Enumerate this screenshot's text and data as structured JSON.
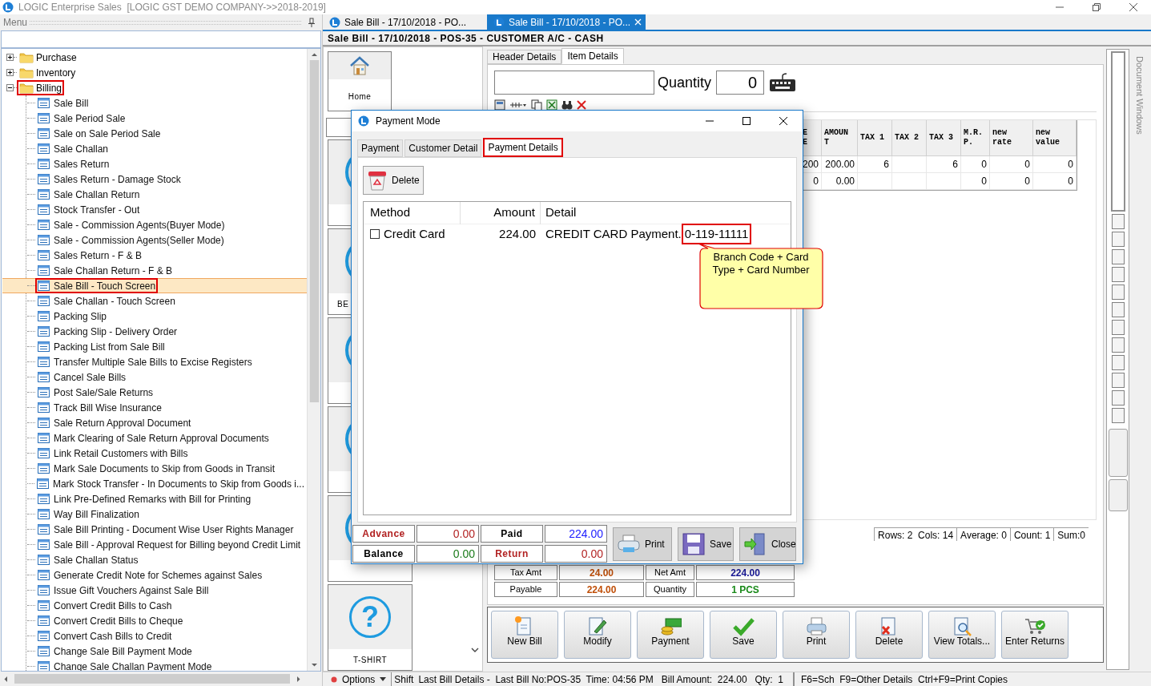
{
  "window": {
    "title": "LOGIC Enterprise Sales  [LOGIC GST DEMO COMPANY->>2018-2019]"
  },
  "menu": {
    "title": "Menu",
    "tree": [
      {
        "label": "Purchase",
        "expanded": false,
        "selected": false,
        "annotated": false
      },
      {
        "label": "Inventory",
        "expanded": false,
        "selected": false,
        "annotated": false
      },
      {
        "label": "Billing",
        "expanded": true,
        "selected": false,
        "annotated": true,
        "children": [
          {
            "label": "Sale Bill",
            "selected": false,
            "annotated": false
          },
          {
            "label": "Sale Period Sale",
            "selected": false,
            "annotated": false
          },
          {
            "label": "Sale on Sale Period Sale",
            "selected": false,
            "annotated": false
          },
          {
            "label": "Sale Challan",
            "selected": false,
            "annotated": false
          },
          {
            "label": "Sales Return",
            "selected": false,
            "annotated": false
          },
          {
            "label": "Sales Return - Damage Stock",
            "selected": false,
            "annotated": false
          },
          {
            "label": "Sale Challan Return",
            "selected": false,
            "annotated": false
          },
          {
            "label": "Stock Transfer - Out",
            "selected": false,
            "annotated": false
          },
          {
            "label": "Sale - Commission Agents(Buyer Mode)",
            "selected": false,
            "annotated": false
          },
          {
            "label": "Sale - Commission Agents(Seller Mode)",
            "selected": false,
            "annotated": false
          },
          {
            "label": "Sales Return - F & B",
            "selected": false,
            "annotated": false
          },
          {
            "label": "Sale Challan Return - F & B",
            "selected": false,
            "annotated": false
          },
          {
            "label": "Sale Bill - Touch Screen",
            "selected": true,
            "annotated": true
          },
          {
            "label": "Sale Challan - Touch Screen",
            "selected": false,
            "annotated": false
          },
          {
            "label": "Packing Slip",
            "selected": false,
            "annotated": false
          },
          {
            "label": "Packing Slip - Delivery Order",
            "selected": false,
            "annotated": false
          },
          {
            "label": "Packing List from Sale Bill",
            "selected": false,
            "annotated": false
          },
          {
            "label": "Transfer Multiple Sale Bills to Excise Registers",
            "selected": false,
            "annotated": false
          },
          {
            "label": "Cancel Sale Bills",
            "selected": false,
            "annotated": false
          },
          {
            "label": "Post Sale/Sale Returns",
            "selected": false,
            "annotated": false
          },
          {
            "label": "Track Bill Wise Insurance",
            "selected": false,
            "annotated": false
          },
          {
            "label": "Sale Return Approval Document",
            "selected": false,
            "annotated": false
          },
          {
            "label": "Mark Clearing of Sale Return Approval Documents",
            "selected": false,
            "annotated": false
          },
          {
            "label": "Link Retail Customers with Bills",
            "selected": false,
            "annotated": false
          },
          {
            "label": "Mark Sale Documents to Skip from Goods in Transit",
            "selected": false,
            "annotated": false
          },
          {
            "label": "Mark Stock Transfer - In Documents to Skip from Goods i...",
            "selected": false,
            "annotated": false
          },
          {
            "label": "Link Pre-Defined Remarks with Bill for Printing",
            "selected": false,
            "annotated": false
          },
          {
            "label": "Way Bill Finalization",
            "selected": false,
            "annotated": false
          },
          {
            "label": "Sale Bill Printing - Document Wise User Rights Manager",
            "selected": false,
            "annotated": false
          },
          {
            "label": "Sale Bill - Approval Request for Billing beyond Credit Limit",
            "selected": false,
            "annotated": false
          },
          {
            "label": "Sale Challan Status",
            "selected": false,
            "annotated": false
          },
          {
            "label": "Generate Credit Note for Schemes against Sales",
            "selected": false,
            "annotated": false
          },
          {
            "label": "Issue Gift Vouchers Against Sale Bill",
            "selected": false,
            "annotated": false
          },
          {
            "label": "Convert Credit Bills to Cash",
            "selected": false,
            "annotated": false
          },
          {
            "label": "Convert Credit Bills to Cheque",
            "selected": false,
            "annotated": false
          },
          {
            "label": "Convert Cash Bills to Credit",
            "selected": false,
            "annotated": false
          },
          {
            "label": "Change Sale Bill Payment Mode",
            "selected": false,
            "annotated": false
          },
          {
            "label": "Change Sale Challan Payment Mode",
            "selected": false,
            "annotated": false
          }
        ]
      }
    ]
  },
  "document_tabs": [
    {
      "label": "Sale Bill - 17/10/2018 - PO...",
      "selected": false
    },
    {
      "label": "Sale Bill - 17/10/2018 - PO...",
      "selected": true
    }
  ],
  "document_title": "Sale Bill - 17/10/2018 - POS-35 - CUSTOMER A/C - CASH",
  "tiles": [
    {
      "kind": "home",
      "label": "Home"
    },
    {
      "kind": "bar"
    },
    {
      "kind": "item"
    },
    {
      "kind": "item",
      "label": "BE"
    },
    {
      "kind": "item"
    },
    {
      "kind": "item"
    },
    {
      "kind": "item"
    },
    {
      "kind": "help",
      "icon": "?",
      "label": "T-SHIRT"
    }
  ],
  "bill_tabs": [
    {
      "label": "Header Details",
      "selected": false
    },
    {
      "label": "Item Details",
      "selected": true
    }
  ],
  "item_entry": {
    "quantity_label": "Quantity",
    "quantity": "0"
  },
  "items_grid": {
    "columns": [
      "E\nE",
      "AMOUN\nT",
      "TAX 1",
      "TAX 2",
      "TAX 3",
      "M.R.\nP.",
      "new\nrate",
      "new\nvalue"
    ],
    "rows": [
      [
        "200",
        "200.00",
        "6",
        "",
        "6",
        "0",
        "0",
        "0"
      ],
      [
        "0",
        "0.00",
        "",
        "",
        "",
        "0",
        "0",
        "0"
      ]
    ]
  },
  "grid_stats": [
    "Rows: 2  Cols: 14",
    "Average: 0",
    "Count: 1",
    "Sum:0"
  ],
  "totals": [
    {
      "label": "Tax Amt",
      "value": "24.00",
      "color": "#c0500a"
    },
    {
      "label": "Net Amt",
      "value": "224.00",
      "color": "#1a1a9a"
    },
    {
      "label": "Payable",
      "value": "224.00",
      "color": "#c0500a"
    },
    {
      "label": "Quantity",
      "value": "1 PCS",
      "color": "#1a8a1a"
    }
  ],
  "actions": [
    {
      "kind": "new",
      "label": "New Bill"
    },
    {
      "kind": "modify",
      "label": "Modify"
    },
    {
      "kind": "payment",
      "label": "Payment"
    },
    {
      "kind": "save",
      "label": "Save"
    },
    {
      "kind": "print",
      "label": "Print"
    },
    {
      "kind": "delete",
      "label": "Delete"
    },
    {
      "kind": "totals",
      "label": "View Totals..."
    },
    {
      "kind": "returns",
      "label": "Enter Returns"
    }
  ],
  "side_panel": {
    "title": "Document Windows"
  },
  "status_bar": {
    "options": "Options",
    "shift": "Shift",
    "details": "Last Bill Details -  Last Bill No:POS-35  Time: 04:56 PM   Bill Amount:  224.00   Qty:  1",
    "keys": "F6=Sch  F9=Other Details  Ctrl+F9=Print Copies"
  },
  "dialog": {
    "title": "Payment Mode",
    "tabs": [
      {
        "label": "Payment",
        "selected": false,
        "annotated": false
      },
      {
        "label": "Customer Detail",
        "selected": false,
        "annotated": false
      },
      {
        "label": "Payment Details",
        "selected": true,
        "annotated": true
      }
    ],
    "delete_button": "Delete",
    "columns": [
      "Method",
      "Amount",
      "Detail"
    ],
    "rows": [
      {
        "method": "Credit Card",
        "checked": false,
        "amount": "224.00",
        "detail": "CREDIT CARD Payment.",
        "detail_code": "0-119-11111",
        "annotated": true
      }
    ],
    "callout": "Branch Code + Card Type + Card Number",
    "summary": [
      {
        "label": "Advance",
        "value": "0.00",
        "kind": "alert",
        "color": "#b22222"
      },
      {
        "label": "Paid",
        "value": "224.00",
        "kind": "normal",
        "color": "#1a1aff"
      },
      {
        "label": "Balance",
        "value": "0.00",
        "kind": "normal",
        "color": "#1a7a1a"
      },
      {
        "label": "Return",
        "value": "0.00",
        "kind": "alert",
        "color": "#b22222"
      }
    ],
    "buttons": [
      {
        "kind": "print",
        "label": "Print"
      },
      {
        "kind": "save",
        "label": "Save"
      },
      {
        "kind": "close",
        "label": "Close"
      }
    ]
  }
}
